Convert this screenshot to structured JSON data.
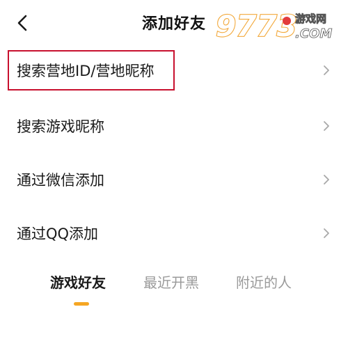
{
  "header": {
    "title": "添加好友",
    "back_icon": "chevron-left-icon"
  },
  "watermark": {
    "brand": "9773",
    "cn_text": "游戏网",
    "en_text": "COM",
    "colors": {
      "brand_fill": "#ffffff",
      "brand_stroke": "#f2a83a",
      "accent": "#e23b3b"
    }
  },
  "menu": {
    "items": [
      {
        "label": "搜索营地ID/营地昵称",
        "icon": "chevron-right-icon",
        "highlighted": true
      },
      {
        "label": "搜索游戏昵称",
        "icon": "chevron-right-icon"
      },
      {
        "label": "通过微信添加",
        "icon": "chevron-right-icon"
      },
      {
        "label": "通过QQ添加",
        "icon": "chevron-right-icon"
      }
    ],
    "highlight_color": "#c8102e"
  },
  "tabs": {
    "items": [
      {
        "label": "游戏好友",
        "active": true
      },
      {
        "label": "最近开黑",
        "active": false
      },
      {
        "label": "附近的人",
        "active": false
      }
    ],
    "indicator_color": "#f5a623"
  }
}
